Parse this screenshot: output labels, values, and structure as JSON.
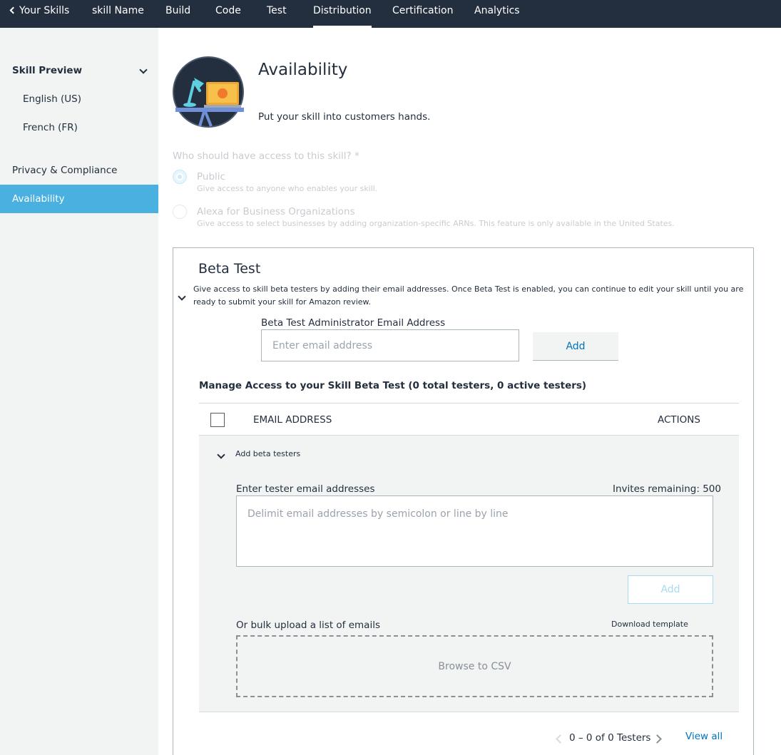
{
  "topnav": {
    "back_label": "Your Skills",
    "items": [
      "skill Name",
      "Build",
      "Code",
      "Test",
      "Distribution",
      "Certification",
      "Analytics"
    ],
    "active": "Distribution"
  },
  "sidebar": {
    "skill_preview": "Skill Preview",
    "english": "English (US)",
    "french": "French (FR)",
    "privacy": "Privacy & Compliance",
    "availability": "Availability"
  },
  "main": {
    "title": "Availability",
    "subtitle": "Put your skill into customers hands.",
    "access_question": "Who should have access to this skill? *",
    "public_label": "Public",
    "public_desc": "Give access to anyone who enables your skill.",
    "a4b_label": "Alexa for Business Organizations",
    "a4b_desc": "Give access to select businesses by adding organization-specific ARNs. This feature is only available in the United States."
  },
  "beta": {
    "title": "Beta Test",
    "desc_line1": "Give access to skill beta testers by adding their email addresses. Once Beta Test is enabled, you can continue to edit your skill until you are",
    "desc_line2": "ready to submit your skill for Amazon review.",
    "admin_label": "Beta Test Administrator Email Address",
    "admin_placeholder": "Enter email address",
    "admin_add": "Add",
    "manage_title": "Manage Access to your Skill Beta Test (0 total testers, 0 active testers)",
    "col_email": "EMAIL ADDRESS",
    "col_actions": "ACTIONS",
    "add_testers": "Add beta testers",
    "tester_label": "Enter tester email addresses",
    "invites": "Invites remaining: 500",
    "tester_placeholder": "Delimit email addresses by semicolon or line by line",
    "tester_add": "Add",
    "bulk_label": "Or bulk upload a list of emails",
    "download_template": "Download template",
    "browse": "Browse to CSV",
    "pagination": "0 – 0 of 0 Testers",
    "view_all": "View all"
  },
  "colors": {
    "nav_bg": "#232f3e",
    "sidebar_bg": "#f2f4f4",
    "accent": "#4ab0e0",
    "link": "#0073bb"
  }
}
